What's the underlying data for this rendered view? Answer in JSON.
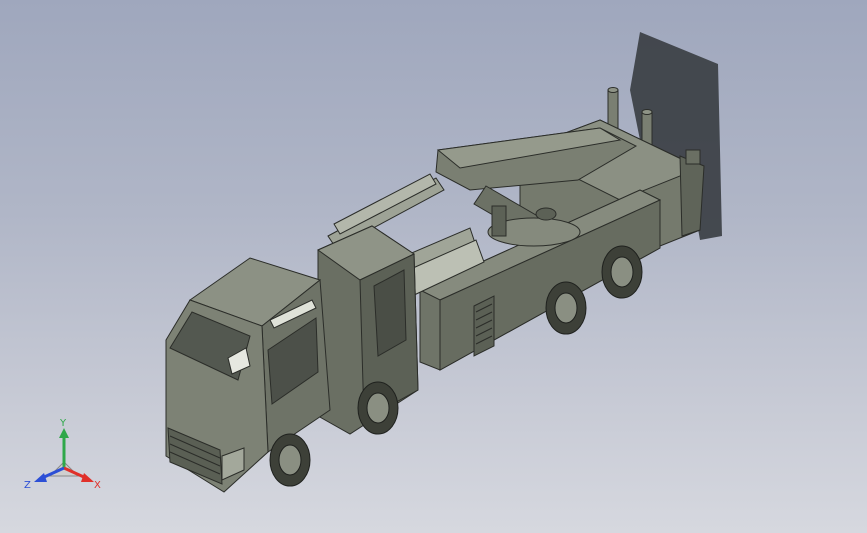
{
  "viewport": {
    "background_top": "#9fa7bd",
    "background_bottom": "#d6d8df"
  },
  "model": {
    "body_color": "#6f7468",
    "shadow_color": "#3d4144"
  },
  "triad": {
    "x_label": "X",
    "y_label": "Y",
    "z_label": "Z",
    "x_color": "#e0302a",
    "y_color": "#2fa84a",
    "z_color": "#2c4fd6"
  }
}
